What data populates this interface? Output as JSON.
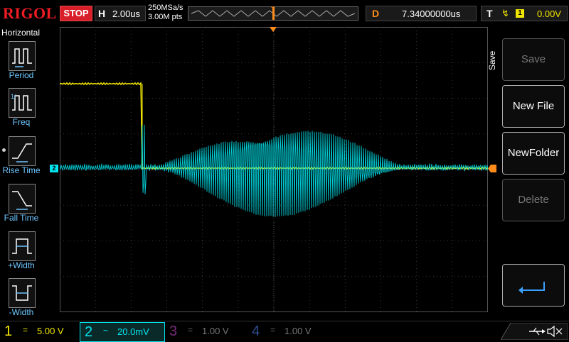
{
  "header": {
    "brand": "RIGOL",
    "run_state": "STOP",
    "horizontal_key": "H",
    "timebase": "2.00us",
    "sample_rate": "250MSa/s",
    "memory_depth": "3.00M pts",
    "trigger_marker_label": "T",
    "delay_key": "D",
    "delay_value": "7.34000000us",
    "trigger_key": "T",
    "trigger_channel": "1",
    "trigger_level": "0.00V"
  },
  "left_menu": {
    "title": "Horizontal",
    "items": [
      {
        "label": "Period",
        "icon": "period-icon"
      },
      {
        "label": "Freq",
        "icon": "frequency-icon"
      },
      {
        "label": "Rise Time",
        "icon": "rise-time-icon"
      },
      {
        "label": "Fall Time",
        "icon": "fall-time-icon"
      },
      {
        "label": "+Width",
        "icon": "positive-width-icon"
      },
      {
        "label": "-Width",
        "icon": "negative-width-icon"
      }
    ]
  },
  "right_menu": {
    "title": "Save",
    "buttons": [
      {
        "label": "Save",
        "enabled": false
      },
      {
        "label": "New File",
        "enabled": true
      },
      {
        "label": "NewFolder",
        "enabled": true
      },
      {
        "label": "Delete",
        "enabled": false
      }
    ],
    "back_icon": "return-arrow-icon"
  },
  "screen_markers": {
    "ch2_marker": "2",
    "trigger_marker": "T"
  },
  "channels": [
    {
      "num": "1",
      "coupling": "=",
      "scale": "5.00 V",
      "color": "#f2e600",
      "active": true
    },
    {
      "num": "2",
      "coupling": "~",
      "scale": "20.0mV",
      "color": "#00e5ee",
      "active": true
    },
    {
      "num": "3",
      "coupling": "=",
      "scale": "1.00 V",
      "color": "#c040c0",
      "active": false
    },
    {
      "num": "4",
      "coupling": "=",
      "scale": "1.00 V",
      "color": "#3a6fd0",
      "active": false
    }
  ],
  "status_icons": [
    "usb-icon",
    "speaker-muted-icon"
  ],
  "colors": {
    "ch1": "#f2e600",
    "ch2": "#00e5ee",
    "trigger": "#ff8c1a",
    "grid": "#3a3a3a",
    "stop": "#d81e28"
  }
}
